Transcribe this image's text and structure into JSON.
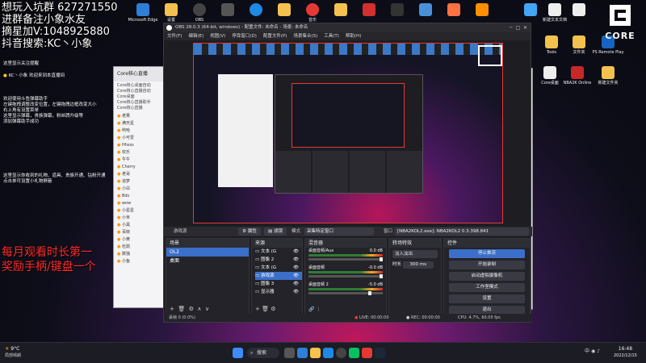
{
  "overlay": {
    "line1": "想玩入坑群 627271550",
    "line2": "进群备注小象水友",
    "line3": "摘星加V:1048925880",
    "line4": "抖音搜索:KC丶小象",
    "promo1": "每月观看时长第一",
    "promo2": "奖励手柄/键盘一个"
  },
  "left_text": {
    "top": "这里显示关注提醒",
    "welcome_user": "KC丶小象 欢迎来到本直播间",
    "info": [
      "欢迎使用斗鱼弹幕助手",
      "左键拖拽调整改变位置，左键拖拽边框改变大小",
      "右上角有设置菜单",
      "这里显示弹幕，贵族弹幕，粉丝牌升级等",
      "添加弹幕助手成功"
    ],
    "info2": [
      "这里显示你收到的礼物、道具、贵族开通、钻粉开通",
      "点击单可设置小礼物屏蔽"
    ]
  },
  "chat_panel": {
    "title": "Core核心直播",
    "items": [
      "Core核心桌面自动",
      "Core核心直播自动",
      "Core桌面",
      "Core核心直播助手",
      "Core核心直播"
    ],
    "names": [
      "老果",
      "满天星",
      "哟哈",
      "小可爱",
      "Hhsss",
      "欢乐",
      "牛牛",
      "Cherry",
      "老哥",
      "追梦",
      "小白",
      "Bds",
      "wow",
      "小星星",
      "小米",
      "小黑",
      "百晓",
      "小黄",
      "杜鹃",
      "数独",
      "小鱼"
    ]
  },
  "desktop_icons": [
    "Microsoft Edge",
    "设置",
    "OBS",
    "音乐",
    "文件夹",
    "新建文本文档",
    "Tools",
    "文件夹",
    "PS Remote Play",
    "Core桌面",
    "NBA2K Online",
    "新建文件夹",
    "Steam"
  ],
  "obs": {
    "title": "OBS 28.0.3 (64-bit, windows) - 配置文件: 未命名 - 场景: 未命名",
    "menu": [
      "文件(F)",
      "编辑(E)",
      "视图(V)",
      "停靠窗口(D)",
      "配置文件(P)",
      "场景集合(S)",
      "工具(T)",
      "帮助(H)"
    ],
    "source_bar": {
      "source": "游戏源",
      "props": "属性",
      "filter": "滤镜",
      "mode": "模式",
      "capture": "采集特定窗口",
      "window_label": "窗口",
      "window": "[NBA2KOL2.exe]: NBA2KOL2 0.3.398.841"
    },
    "scenes": {
      "title": "场景",
      "items": [
        "OL2",
        "桌面"
      ]
    },
    "sources": {
      "title": "来源",
      "items": [
        "文本 (G",
        "图像 2",
        "文本 (G",
        "游戏源",
        "图像 3",
        "显示器"
      ]
    },
    "mixer": {
      "title": "混音器",
      "channels": [
        {
          "name": "桌面音频/Aux",
          "db": "0.0 dB"
        },
        {
          "name": "桌面音频",
          "db": "-0.0 dB"
        },
        {
          "name": "桌面音频 2",
          "db": "-5.0 dB"
        }
      ]
    },
    "transitions": {
      "title": "转场特效",
      "type": "淡入淡出",
      "duration_label": "时长",
      "duration": "300 ms"
    },
    "controls": {
      "title": "控件",
      "buttons": [
        "停止推流",
        "开始录制",
        "启动虚拟摄像机",
        "工作室模式",
        "设置",
        "退出"
      ]
    },
    "status": {
      "live": "LIVE: 00:00:00",
      "rec": "REC: 00:00:00",
      "cpu": "CPU: 4.7%, 60.00 fps",
      "dropped": "丢帧 0 (0.0%)"
    }
  },
  "taskbar": {
    "weather": "9°C",
    "weather_sub": "局部晴朗",
    "search": "搜索",
    "time": "16:48",
    "date": "2022/12/15",
    "ime": "中"
  },
  "brand": {
    "logo": "CORE"
  }
}
